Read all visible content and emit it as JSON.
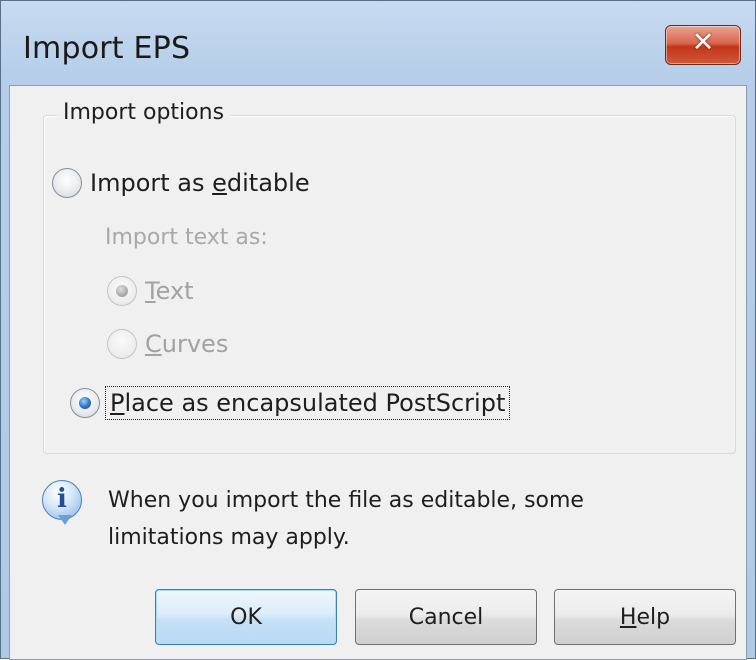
{
  "window": {
    "title": "Import EPS",
    "close_glyph": "✕"
  },
  "group": {
    "label": "Import options"
  },
  "options": {
    "editable_prefix": "Import as ",
    "editable_accel": "e",
    "editable_suffix": "ditable",
    "sublabel": "Import text as:",
    "text_accel": "T",
    "text_suffix": "ext",
    "curves_accel": "C",
    "curves_suffix": "urves",
    "eps_accel": "P",
    "eps_suffix": "lace as encapsulated PostScript"
  },
  "info": {
    "icon": "info-icon",
    "line1": "When you import the file as editable, some",
    "line2": "limitations may apply."
  },
  "buttons": {
    "ok": "OK",
    "cancel": "Cancel",
    "help_accel": "H",
    "help_suffix": "elp"
  },
  "state": {
    "selected_option": "Place as encapsulated PostScript",
    "import_text_as": "Text"
  }
}
